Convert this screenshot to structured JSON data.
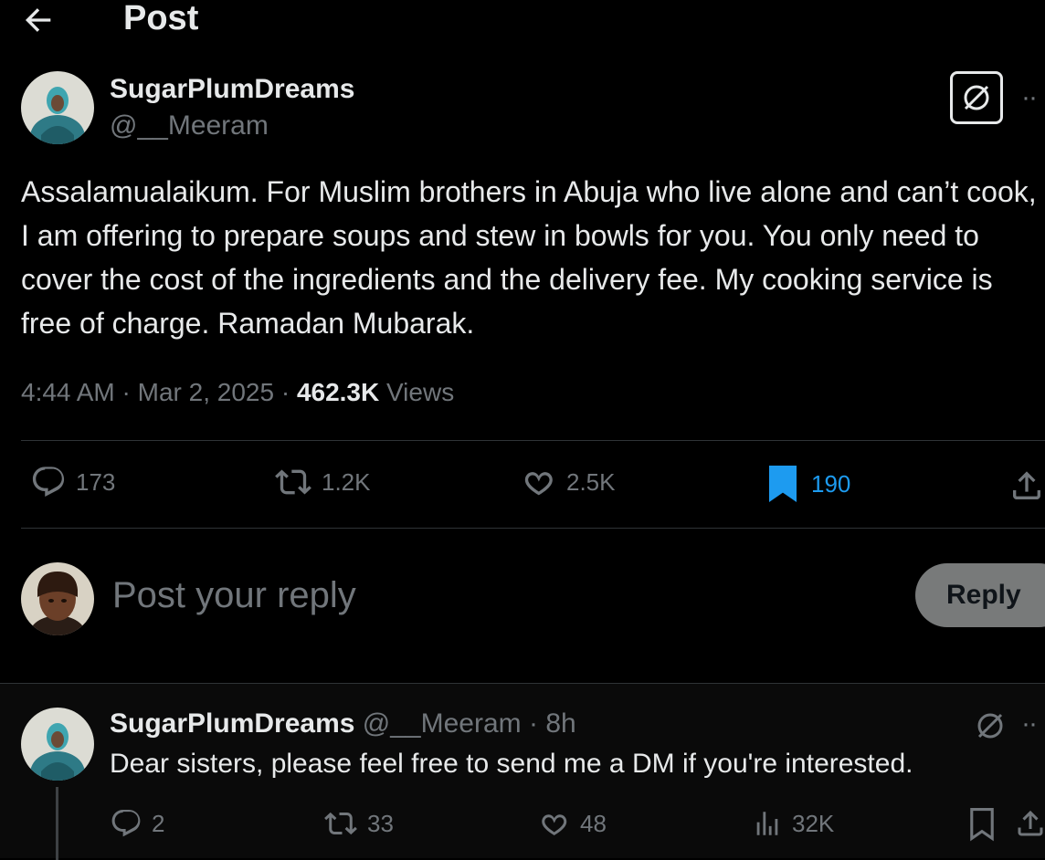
{
  "header": {
    "title": "Post"
  },
  "tweet": {
    "display_name": "SugarPlumDreams",
    "handle": "@__Meeram",
    "text": "Assalamualaikum. For Muslim brothers in Abuja who live alone and can’t cook, I am offering to prepare soups and stew in bowls for you. You only need to cover the cost of the ingredients and the delivery fee. My cooking service is free of charge. Ramadan Mubarak.",
    "time": "4:44 AM",
    "date": "Mar 2, 2025",
    "views_count": "462.3K",
    "views_label": "Views",
    "more_label": "··",
    "actions": {
      "replies": "173",
      "reposts": "1.2K",
      "likes": "2.5K",
      "bookmarks": "190"
    },
    "bookmark_color": "#1d9bf0"
  },
  "reply_box": {
    "placeholder": "Post your reply",
    "button_label": "Reply"
  },
  "comment": {
    "display_name": "SugarPlumDreams",
    "handle": "@__Meeram",
    "age": "8h",
    "separator": "·",
    "text": "Dear sisters, please feel free to send me a DM if you're interested.",
    "more_label": "··",
    "actions": {
      "replies": "2",
      "reposts": "33",
      "likes": "48",
      "views": "32K"
    }
  }
}
